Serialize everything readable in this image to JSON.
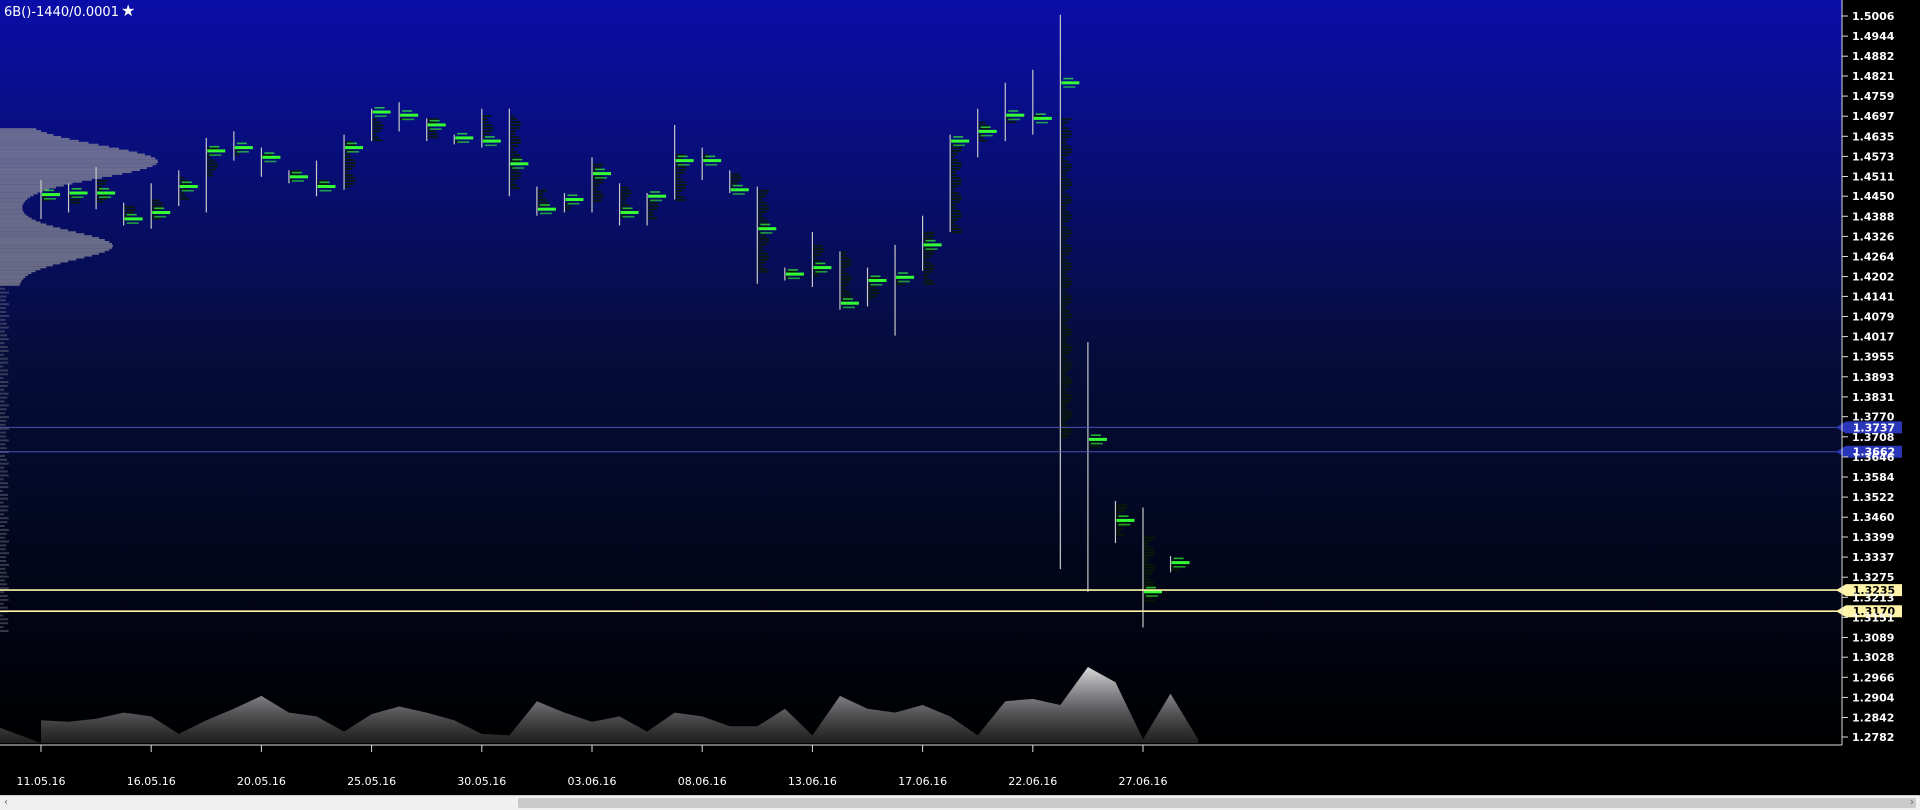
{
  "header": {
    "instrument": "6B()-1440/0.0001",
    "star_glyph": "★"
  },
  "colors": {
    "bg_top": "#0a0ea8",
    "bg_mid": "#050d3a",
    "bg_bottom": "#000000",
    "candle": "#c8c8c8",
    "poc_green": "#33ff33",
    "cluster_dark": "#0b1a06",
    "level_yellow": "#fff4a8",
    "level_blue": "#2a36b8",
    "axis_text": "#ffffff"
  },
  "chart_data": {
    "type": "candlestick-footprint",
    "title": "6B()-1440/0.0001",
    "y_axis": {
      "position": "right",
      "ticks": [
        "1.5006",
        "1.4944",
        "1.4882",
        "1.4821",
        "1.4759",
        "1.4697",
        "1.4635",
        "1.4573",
        "1.4511",
        "1.4450",
        "1.4388",
        "1.4326",
        "1.4264",
        "1.4202",
        "1.4141",
        "1.4079",
        "1.4017",
        "1.3955",
        "1.3893",
        "1.3831",
        "1.3770",
        "1.3708",
        "1.3646",
        "1.3584",
        "1.3522",
        "1.3460",
        "1.3399",
        "1.3337",
        "1.3275",
        "1.3213",
        "1.3151",
        "1.3089",
        "1.3028",
        "1.2966",
        "1.2904",
        "1.2842",
        "1.2782"
      ],
      "ylim": [
        1.2782,
        1.5006
      ]
    },
    "x_axis": {
      "tick_labels": [
        "11.05.16",
        "16.05.16",
        "20.05.16",
        "25.05.16",
        "30.05.16",
        "03.06.16",
        "08.06.16",
        "13.06.16",
        "17.06.16",
        "22.06.16",
        "27.06.16"
      ],
      "tick_bar_index": [
        0,
        4,
        8,
        12,
        16,
        20,
        24,
        28,
        32,
        36,
        40
      ]
    },
    "levels": [
      {
        "price": 1.3737,
        "label": "1.3737",
        "style": "blue"
      },
      {
        "price": 1.3662,
        "label": "1.3662",
        "style": "blue"
      },
      {
        "price": 1.3235,
        "label": "1.3235",
        "style": "yellow"
      },
      {
        "price": 1.317,
        "label": "1.3170",
        "style": "yellow"
      }
    ],
    "bars": [
      {
        "d": "11.05.16",
        "o": 1.444,
        "h": 1.45,
        "l": 1.438,
        "c": 1.446,
        "poc": 1.4455
      },
      {
        "d": "12.05.16",
        "o": 1.446,
        "h": 1.449,
        "l": 1.44,
        "c": 1.443,
        "poc": 1.446
      },
      {
        "d": "13.05.16",
        "o": 1.443,
        "h": 1.454,
        "l": 1.441,
        "c": 1.45,
        "poc": 1.446
      },
      {
        "d": "14.05.16",
        "o": 1.442,
        "h": 1.443,
        "l": 1.436,
        "c": 1.438,
        "poc": 1.438
      },
      {
        "d": "16.05.16",
        "o": 1.438,
        "h": 1.449,
        "l": 1.435,
        "c": 1.444,
        "poc": 1.44
      },
      {
        "d": "17.05.16",
        "o": 1.444,
        "h": 1.453,
        "l": 1.442,
        "c": 1.451,
        "poc": 1.448
      },
      {
        "d": "18.05.16",
        "o": 1.451,
        "h": 1.463,
        "l": 1.44,
        "c": 1.46,
        "poc": 1.459
      },
      {
        "d": "19.05.16",
        "o": 1.46,
        "h": 1.465,
        "l": 1.456,
        "c": 1.458,
        "poc": 1.46
      },
      {
        "d": "20.05.16",
        "o": 1.458,
        "h": 1.46,
        "l": 1.451,
        "c": 1.457,
        "poc": 1.457
      },
      {
        "d": "21.05.16",
        "o": 1.453,
        "h": 1.453,
        "l": 1.449,
        "c": 1.45,
        "poc": 1.451
      },
      {
        "d": "23.05.16",
        "o": 1.45,
        "h": 1.456,
        "l": 1.445,
        "c": 1.448,
        "poc": 1.448
      },
      {
        "d": "24.05.16",
        "o": 1.448,
        "h": 1.464,
        "l": 1.447,
        "c": 1.462,
        "poc": 1.46
      },
      {
        "d": "25.05.16",
        "o": 1.462,
        "h": 1.472,
        "l": 1.462,
        "c": 1.469,
        "poc": 1.471
      },
      {
        "d": "26.05.16",
        "o": 1.469,
        "h": 1.474,
        "l": 1.465,
        "c": 1.47,
        "poc": 1.47
      },
      {
        "d": "27.05.16",
        "o": 1.469,
        "h": 1.469,
        "l": 1.462,
        "c": 1.463,
        "poc": 1.467
      },
      {
        "d": "28.05.16",
        "o": 1.463,
        "h": 1.464,
        "l": 1.461,
        "c": 1.462,
        "poc": 1.463
      },
      {
        "d": "30.05.16",
        "o": 1.462,
        "h": 1.472,
        "l": 1.46,
        "c": 1.47,
        "poc": 1.462
      },
      {
        "d": "31.05.16",
        "o": 1.47,
        "h": 1.472,
        "l": 1.445,
        "c": 1.447,
        "poc": 1.455
      },
      {
        "d": "01.06.16",
        "o": 1.447,
        "h": 1.448,
        "l": 1.439,
        "c": 1.441,
        "poc": 1.441
      },
      {
        "d": "02.06.16",
        "o": 1.441,
        "h": 1.446,
        "l": 1.44,
        "c": 1.443,
        "poc": 1.444
      },
      {
        "d": "03.06.16",
        "o": 1.443,
        "h": 1.457,
        "l": 1.44,
        "c": 1.455,
        "poc": 1.452
      },
      {
        "d": "04.06.16",
        "o": 1.448,
        "h": 1.449,
        "l": 1.436,
        "c": 1.438,
        "poc": 1.44
      },
      {
        "d": "06.06.16",
        "o": 1.438,
        "h": 1.446,
        "l": 1.436,
        "c": 1.444,
        "poc": 1.445
      },
      {
        "d": "07.06.16",
        "o": 1.444,
        "h": 1.467,
        "l": 1.444,
        "c": 1.458,
        "poc": 1.456
      },
      {
        "d": "08.06.16",
        "o": 1.458,
        "h": 1.46,
        "l": 1.45,
        "c": 1.456,
        "poc": 1.456
      },
      {
        "d": "09.06.16",
        "o": 1.452,
        "h": 1.453,
        "l": 1.446,
        "c": 1.447,
        "poc": 1.447
      },
      {
        "d": "10.06.16",
        "o": 1.447,
        "h": 1.448,
        "l": 1.418,
        "c": 1.422,
        "poc": 1.435
      },
      {
        "d": "11.06.16",
        "o": 1.422,
        "h": 1.423,
        "l": 1.419,
        "c": 1.42,
        "poc": 1.421
      },
      {
        "d": "13.06.16",
        "o": 1.42,
        "h": 1.434,
        "l": 1.417,
        "c": 1.43,
        "poc": 1.423
      },
      {
        "d": "14.06.16",
        "o": 1.428,
        "h": 1.428,
        "l": 1.41,
        "c": 1.413,
        "poc": 1.412
      },
      {
        "d": "15.06.16",
        "o": 1.413,
        "h": 1.423,
        "l": 1.411,
        "c": 1.42,
        "poc": 1.419
      },
      {
        "d": "16.06.16",
        "o": 1.42,
        "h": 1.43,
        "l": 1.402,
        "c": 1.418,
        "poc": 1.42
      },
      {
        "d": "17.06.16",
        "o": 1.418,
        "h": 1.439,
        "l": 1.422,
        "c": 1.434,
        "poc": 1.43
      },
      {
        "d": "18.06.16",
        "o": 1.434,
        "h": 1.464,
        "l": 1.434,
        "c": 1.462,
        "poc": 1.462
      },
      {
        "d": "20.06.16",
        "o": 1.462,
        "h": 1.472,
        "l": 1.457,
        "c": 1.468,
        "poc": 1.465
      },
      {
        "d": "21.06.16",
        "o": 1.468,
        "h": 1.48,
        "l": 1.462,
        "c": 1.47,
        "poc": 1.47
      },
      {
        "d": "22.06.16",
        "o": 1.47,
        "h": 1.484,
        "l": 1.464,
        "c": 1.469,
        "poc": 1.469
      },
      {
        "d": "23.06.16",
        "o": 1.469,
        "h": 1.501,
        "l": 1.33,
        "c": 1.37,
        "poc": 1.48
      },
      {
        "d": "24.06.16",
        "o": 1.37,
        "h": 1.4,
        "l": 1.323,
        "c": 1.368,
        "poc": 1.37
      },
      {
        "d": "25.06.16",
        "o": 1.35,
        "h": 1.351,
        "l": 1.338,
        "c": 1.34,
        "poc": 1.345
      },
      {
        "d": "27.06.16",
        "o": 1.34,
        "h": 1.349,
        "l": 1.312,
        "c": 1.32,
        "poc": 1.323
      },
      {
        "d": "28.06.16",
        "o": 1.33,
        "h": 1.334,
        "l": 1.329,
        "c": 1.332,
        "poc": 1.332
      }
    ],
    "volume_profile": {
      "side": "left",
      "poc_price": 1.456
    },
    "volume_area": [
      0.3,
      0.28,
      0.32,
      0.4,
      0.35,
      0.12,
      0.3,
      0.45,
      0.62,
      0.4,
      0.35,
      0.15,
      0.38,
      0.48,
      0.4,
      0.3,
      0.12,
      0.1,
      0.55,
      0.4,
      0.28,
      0.35,
      0.15,
      0.4,
      0.35,
      0.22,
      0.22,
      0.45,
      0.1,
      0.62,
      0.45,
      0.4,
      0.5,
      0.35,
      0.1,
      0.55,
      0.58,
      0.5,
      1.0,
      0.8,
      0.05,
      0.65,
      0.05
    ]
  }
}
